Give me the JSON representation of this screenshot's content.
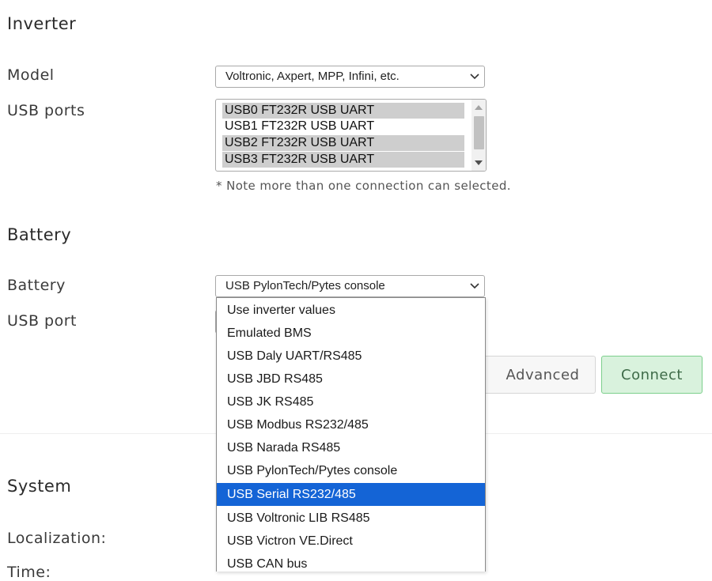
{
  "inverter": {
    "title": "Inverter",
    "model_label": "Model",
    "model_value": "Voltronic, Axpert, MPP, Infini, etc.",
    "usb_ports_label": "USB ports",
    "usb_ports": [
      {
        "label": "USB0 FT232R USB UART",
        "selected": true
      },
      {
        "label": "USB1 FT232R USB UART",
        "selected": false
      },
      {
        "label": "USB2 FT232R USB UART",
        "selected": true
      },
      {
        "label": "USB3 FT232R USB UART",
        "selected": true
      }
    ],
    "note": "* Note more than one connection can selected."
  },
  "battery": {
    "title": "Battery",
    "battery_label": "Battery",
    "battery_value": "USB PylonTech/Pytes console",
    "usb_port_label": "USB port",
    "options": [
      "Use inverter values",
      "Emulated BMS",
      "USB Daly UART/RS485",
      "USB JBD RS485",
      "USB JK RS485",
      "USB Modbus RS232/485",
      "USB Narada RS485",
      "USB PylonTech/Pytes console",
      "USB Serial RS232/485",
      "USB Voltronic LIB RS485",
      "USB Victron VE.Direct",
      "USB CAN bus"
    ],
    "highlighted_option": "USB Serial RS232/485"
  },
  "actions": {
    "advanced_label": "Advanced",
    "connect_label": "Connect"
  },
  "system": {
    "title": "System",
    "localization_label": "Localization:",
    "time_label": "Time:"
  },
  "colors": {
    "highlight": "#1464d6",
    "connect_bg": "#d9f2dd",
    "connect_border": "#7ccf8c"
  }
}
